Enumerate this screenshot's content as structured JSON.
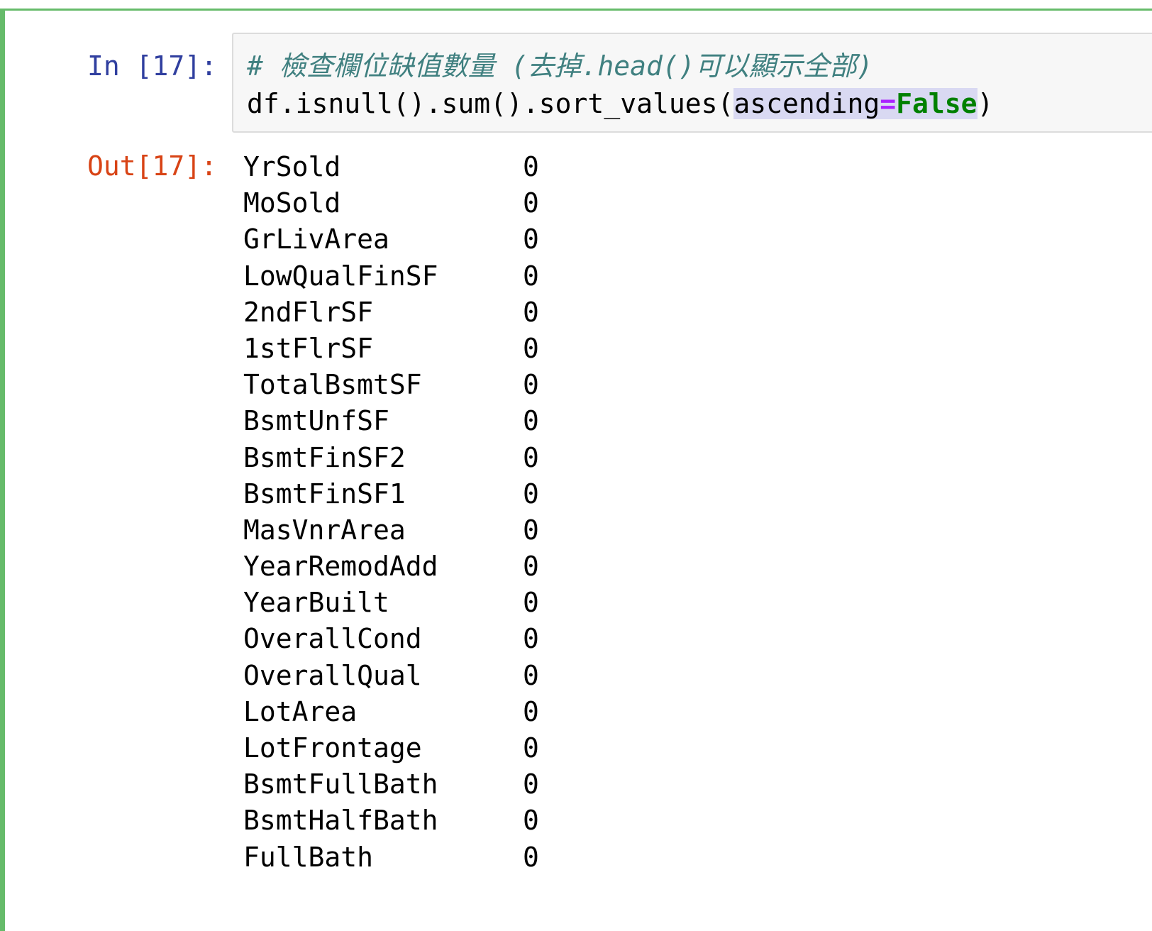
{
  "cell": {
    "in_prompt": "In [17]:",
    "out_prompt": "Out[17]:",
    "code": {
      "comment": "# 檢查欄位缺值數量 (去掉.head()可以顯示全部)",
      "line2_prefix": "df.isnull().sum().sort_values(",
      "arg_name": "ascending",
      "arg_op": "=",
      "arg_value": "False",
      "line2_suffix": ")"
    },
    "output_rows": [
      {
        "name": "YrSold",
        "value": "0"
      },
      {
        "name": "MoSold",
        "value": "0"
      },
      {
        "name": "GrLivArea",
        "value": "0"
      },
      {
        "name": "LowQualFinSF",
        "value": "0"
      },
      {
        "name": "2ndFlrSF",
        "value": "0"
      },
      {
        "name": "1stFlrSF",
        "value": "0"
      },
      {
        "name": "TotalBsmtSF",
        "value": "0"
      },
      {
        "name": "BsmtUnfSF",
        "value": "0"
      },
      {
        "name": "BsmtFinSF2",
        "value": "0"
      },
      {
        "name": "BsmtFinSF1",
        "value": "0"
      },
      {
        "name": "MasVnrArea",
        "value": "0"
      },
      {
        "name": "YearRemodAdd",
        "value": "0"
      },
      {
        "name": "YearBuilt",
        "value": "0"
      },
      {
        "name": "OverallCond",
        "value": "0"
      },
      {
        "name": "OverallQual",
        "value": "0"
      },
      {
        "name": "LotArea",
        "value": "0"
      },
      {
        "name": "LotFrontage",
        "value": "0"
      },
      {
        "name": "BsmtFullBath",
        "value": "0"
      },
      {
        "name": "BsmtHalfBath",
        "value": "0"
      },
      {
        "name": "FullBath",
        "value": "0"
      }
    ]
  },
  "colors": {
    "cell_border": "#66bb6a",
    "in_prompt": "#303f9f",
    "out_prompt": "#d84315",
    "comment": "#408080",
    "keyword": "#008000",
    "operator": "#aa22ff"
  }
}
